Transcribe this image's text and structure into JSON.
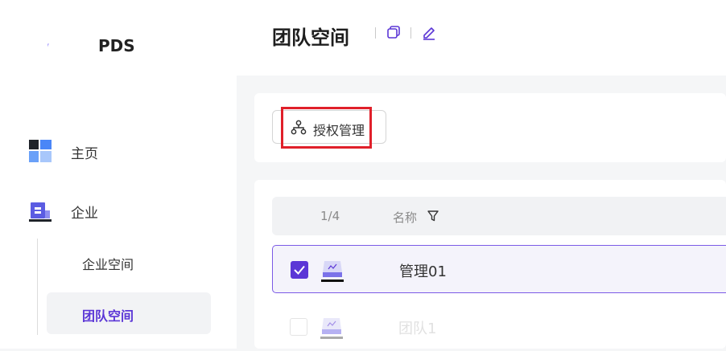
{
  "app": {
    "logo_text": "PDS",
    "logo_mark": "ᶠ"
  },
  "sidebar": {
    "items": [
      {
        "label": "主页",
        "icon": "dashboard-icon"
      },
      {
        "label": "企业",
        "icon": "building-icon"
      }
    ],
    "sub_items": [
      {
        "label": "企业空间",
        "active": false
      },
      {
        "label": "团队空间",
        "active": true
      }
    ]
  },
  "header": {
    "title": "团队空间",
    "icons": [
      "copy-icon",
      "edit-icon"
    ]
  },
  "toolbar": {
    "auth_label": "授权管理",
    "auth_icon": "org-tree-icon"
  },
  "table": {
    "count": "1/4",
    "column_name": "名称",
    "rows": [
      {
        "name": "管理01",
        "selected": true
      },
      {
        "name": "团队1",
        "selected": false
      }
    ]
  },
  "colors": {
    "accent": "#5b36d6",
    "highlight": "#e0202a"
  }
}
